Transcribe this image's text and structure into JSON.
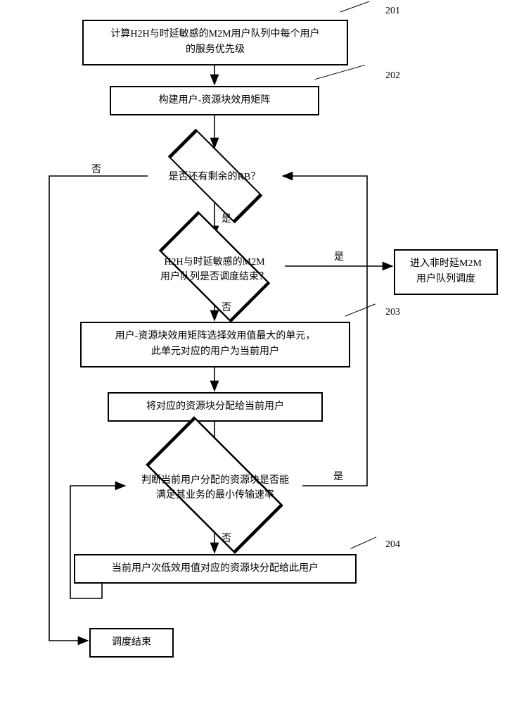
{
  "steps": {
    "s201": "计算H2H与时延敏感的M2M用户队列中每个用户\n的服务优先级",
    "s202": "构建用户-资源块效用矩阵",
    "s203": "用户-资源块效用矩阵选择效用值最大的单元，\n此单元对应的用户为当前用户",
    "alloc": "将对应的资源块分配给当前用户",
    "s204": "当前用户次低效用值对应的资源块分配给此用户",
    "nondelay": "进入非时延M2M\n用户队列调度",
    "end": "调度结束"
  },
  "decisions": {
    "d1": "是否还有剩余的RB？",
    "d2": "H2H与时延敏感的M2M\n用户队列是否调度结束？",
    "d3": "判断当前用户分配的资源块是否能\n满足其业务的最小传输速率"
  },
  "edges": {
    "yes": "是",
    "no": "否"
  },
  "refs": {
    "r201": "201",
    "r202": "202",
    "r203": "203",
    "r204": "204"
  }
}
